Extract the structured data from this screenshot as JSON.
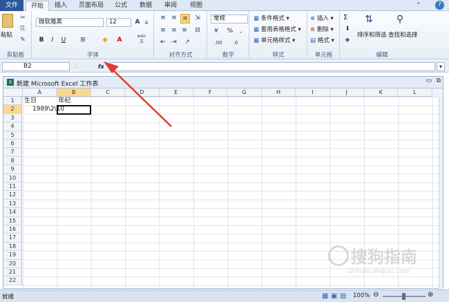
{
  "tabs": [
    {
      "label": "文件"
    },
    {
      "label": "开始"
    },
    {
      "label": "插入"
    },
    {
      "label": "页面布局"
    },
    {
      "label": "公式"
    },
    {
      "label": "数据"
    },
    {
      "label": "审阅"
    },
    {
      "label": "视图"
    }
  ],
  "ribbon": {
    "clipboard": {
      "label": "剪贴板",
      "paste": "粘贴"
    },
    "font": {
      "label": "字体",
      "name": "微软雅黑",
      "size": "12",
      "bold": "B",
      "italic": "I",
      "underline": "U",
      "grow": "A",
      "shrink": "A",
      "fontcolor": "A",
      "wen": "wén",
      "wen2": "文"
    },
    "align": {
      "label": "对齐方式"
    },
    "number": {
      "label": "数字",
      "format": "常规",
      "percent": "%",
      "comma": ",",
      "dec_add": ".00",
      "dec_rem": ".0"
    },
    "styles": {
      "label": "样式",
      "cond": "条件格式",
      "table": "套用表格格式",
      "cell": "单元格样式"
    },
    "cells": {
      "label": "单元格",
      "insert": "插入",
      "delete": "删除",
      "format": "格式"
    },
    "edit": {
      "label": "编辑",
      "sum": "Σ",
      "sort": "排序和筛选",
      "find": "查找和选择"
    }
  },
  "formula_bar": {
    "name_box": "B2",
    "fx": "fx",
    "content": ""
  },
  "workbook": {
    "title": "新建 Microsoft Excel 工作表"
  },
  "columns": [
    "A",
    "B",
    "C",
    "D",
    "E",
    "F",
    "G",
    "H",
    "I",
    "J",
    "K",
    "L"
  ],
  "rows": [
    "1",
    "2",
    "3",
    "4",
    "5",
    "6",
    "7",
    "8",
    "9",
    "10",
    "11",
    "12",
    "13",
    "14",
    "15",
    "16",
    "17",
    "18",
    "19",
    "20",
    "21",
    "22"
  ],
  "cells": {
    "A1": "生日",
    "B1": "年纪",
    "A2": "1989\\2\\10"
  },
  "status": {
    "ready": "就绪",
    "zoom": "100%"
  },
  "watermark": {
    "text": "搜狗指南",
    "url": "zhinan.sogou.com"
  }
}
